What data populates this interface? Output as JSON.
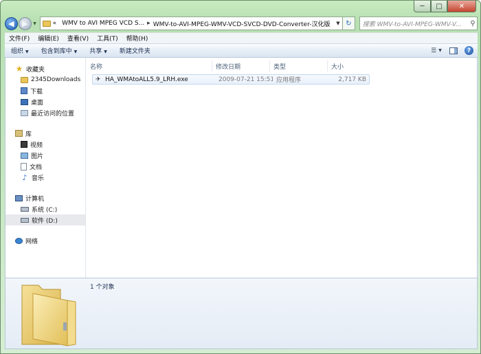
{
  "window": {
    "caption_minimize": "─",
    "caption_maximize": "□",
    "caption_close": "✕"
  },
  "address": {
    "prefix": "«",
    "crumbs": [
      "WMV to AVI MPEG VCD S...",
      "WMV-to-AVI-MPEG-WMV-VCD-SVCD-DVD-Converter-汉化版"
    ],
    "separator": "▸"
  },
  "search": {
    "placeholder": "搜索 WMV-to-AVI-MPEG-WMV-V..."
  },
  "menu": [
    "文件(F)",
    "编辑(E)",
    "查看(V)",
    "工具(T)",
    "帮助(H)"
  ],
  "commands": {
    "organize": "组织",
    "include_library": "包含到库中",
    "share": "共享",
    "new_folder": "新建文件夹"
  },
  "nav": {
    "favorites": {
      "label": "收藏夹",
      "items": [
        "2345Downloads",
        "下载",
        "桌面",
        "最近访问的位置"
      ]
    },
    "libraries": {
      "label": "库",
      "items": [
        "视频",
        "图片",
        "文档",
        "音乐"
      ]
    },
    "computer": {
      "label": "计算机",
      "items": [
        "系统 (C:)",
        "软件 (D:)"
      ]
    },
    "network": {
      "label": "网络"
    }
  },
  "columns": {
    "name": "名称",
    "date": "修改日期",
    "type": "类型",
    "size": "大小"
  },
  "files": [
    {
      "name": "HA_WMAtoALL5.9_LRH.exe",
      "date": "2009-07-21 15:51",
      "type": "应用程序",
      "size": "2,717 KB"
    }
  ],
  "details": {
    "count": "1 个对象"
  }
}
